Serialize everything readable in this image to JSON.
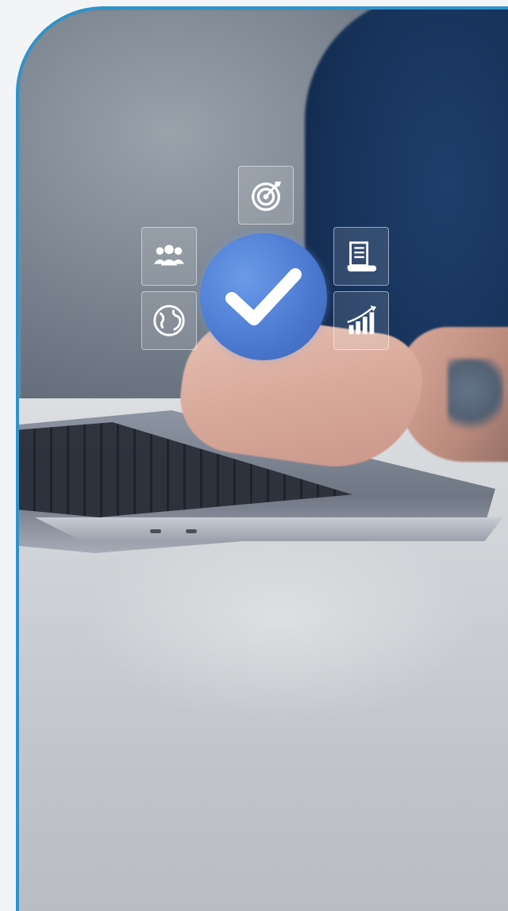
{
  "scene": {
    "icons": {
      "target": "target-icon",
      "team": "team-icon",
      "document": "document-icon",
      "globe": "globe-icon",
      "chart": "growth-chart-icon",
      "check": "checkmark-icon"
    },
    "colors": {
      "frame_border": "#2f93c9",
      "check_circle": "#4a78cf",
      "page_background": "#f3f4f6"
    }
  }
}
